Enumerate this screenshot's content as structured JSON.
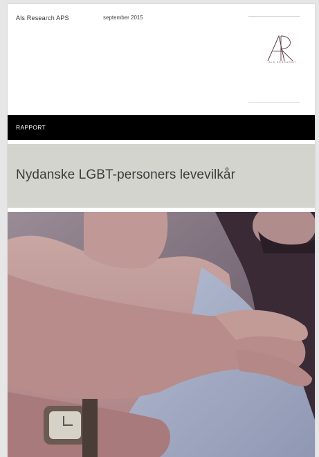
{
  "header": {
    "company": "Als Research APS",
    "date": "september 2015",
    "logo_subtitle": "ALS RESEARCH"
  },
  "band": {
    "label": "RAPPORT"
  },
  "title": "Nydanske LGBT-personers levevilkår",
  "colors": {
    "band": "#000000",
    "title_background": "#d4d4ce",
    "logo": "#5a3a4a"
  },
  "icons": {
    "logo": "ar-monogram-icon"
  }
}
